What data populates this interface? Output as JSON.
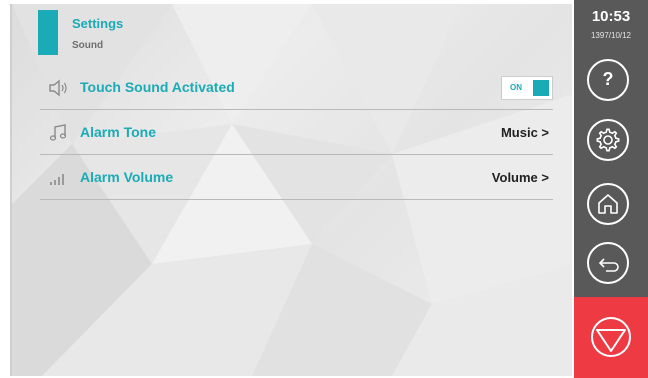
{
  "header": {
    "title": "Settings",
    "subtitle": "Sound"
  },
  "rows": [
    {
      "label": "Touch Sound Activated",
      "icon": "speaker-icon",
      "toggle_text": "ON",
      "toggle_on": true
    },
    {
      "label": "Alarm Tone",
      "icon": "music-note-icon",
      "value": "Music >"
    },
    {
      "label": "Alarm Volume",
      "icon": "signal-bars-icon",
      "value": "Volume >"
    }
  ],
  "sidebar": {
    "time": "10:53",
    "date": "1397/10/12",
    "buttons": [
      {
        "icon": "help-icon",
        "label": "?"
      },
      {
        "icon": "gear-icon"
      },
      {
        "icon": "home-icon"
      },
      {
        "icon": "back-icon"
      }
    ],
    "stop_icon": "stop-triangle-icon"
  },
  "colors": {
    "accent": "#1aabb7",
    "sidebar_bg": "#595959",
    "stop_bg": "#ee3a43"
  }
}
